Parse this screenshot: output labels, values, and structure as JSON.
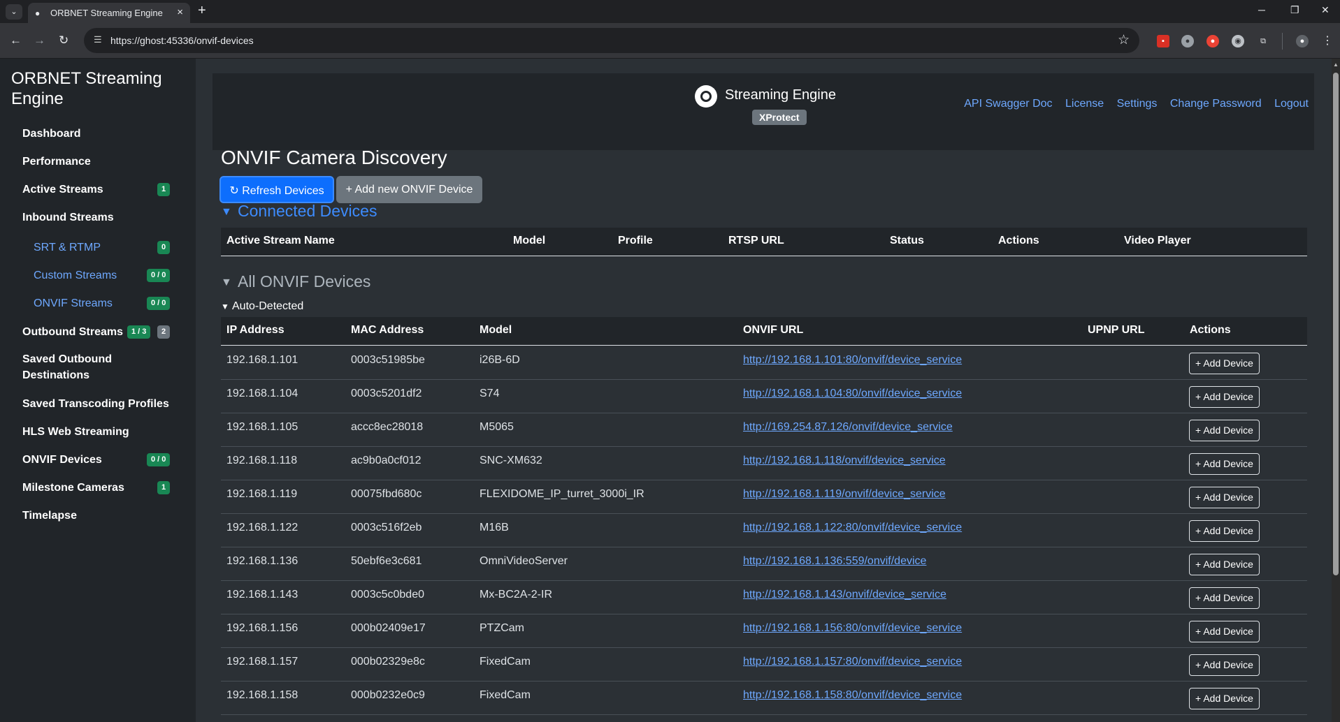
{
  "browser": {
    "tab_title": "ORBNET Streaming Engine",
    "url": "https://ghost:45336/onvif-devices"
  },
  "sidebar": {
    "brand": "ORBNET Streaming Engine",
    "items": [
      {
        "label": "Dashboard"
      },
      {
        "label": "Performance"
      },
      {
        "label": "Active Streams",
        "badge": "1"
      },
      {
        "label": "Inbound Streams"
      },
      {
        "label": "SRT & RTMP",
        "badge": "0"
      },
      {
        "label": "Custom Streams",
        "badge": "0 / 0"
      },
      {
        "label": "ONVIF Streams",
        "badge": "0 / 0"
      },
      {
        "label": "Outbound Streams",
        "badge": "1 / 3",
        "badge2": "2"
      },
      {
        "label": "Saved Outbound Destinations"
      },
      {
        "label": "Saved Transcoding Profiles"
      },
      {
        "label": "HLS Web Streaming"
      },
      {
        "label": "ONVIF Devices",
        "badge": "0 / 0"
      },
      {
        "label": "Milestone Cameras",
        "badge": "1"
      },
      {
        "label": "Timelapse"
      }
    ]
  },
  "header": {
    "title": "Streaming Engine",
    "edition_badge": "XProtect",
    "links": [
      "API Swagger Doc",
      "License",
      "Settings",
      "Change Password",
      "Logout"
    ]
  },
  "page": {
    "title": "ONVIF Camera Discovery",
    "refresh_label": "↻ Refresh Devices",
    "add_label": "+ Add new ONVIF Device"
  },
  "connected": {
    "heading": "Connected Devices",
    "columns": [
      "Active Stream Name",
      "Model",
      "Profile",
      "RTSP URL",
      "Status",
      "Actions",
      "Video Player"
    ]
  },
  "all_devices": {
    "heading": "All ONVIF Devices",
    "subheading": "Auto-Detected",
    "columns": [
      "IP Address",
      "MAC Address",
      "Model",
      "ONVIF URL",
      "UPNP URL",
      "Actions"
    ],
    "add_device_label": "+ Add Device",
    "rows": [
      {
        "ip": "192.168.1.101",
        "mac": "0003c51985be",
        "model": "i26B-6D",
        "url": "http://192.168.1.101:80/onvif/device_service",
        "upnp": ""
      },
      {
        "ip": "192.168.1.104",
        "mac": "0003c5201df2",
        "model": "S74",
        "url": "http://192.168.1.104:80/onvif/device_service",
        "upnp": ""
      },
      {
        "ip": "192.168.1.105",
        "mac": "accc8ec28018",
        "model": "M5065",
        "url": "http://169.254.87.126/onvif/device_service",
        "upnp": ""
      },
      {
        "ip": "192.168.1.118",
        "mac": "ac9b0a0cf012",
        "model": "SNC-XM632",
        "url": "http://192.168.1.118/onvif/device_service",
        "upnp": ""
      },
      {
        "ip": "192.168.1.119",
        "mac": "00075fbd680c",
        "model": "FLEXIDOME_IP_turret_3000i_IR",
        "url": "http://192.168.1.119/onvif/device_service",
        "upnp": ""
      },
      {
        "ip": "192.168.1.122",
        "mac": "0003c516f2eb",
        "model": "M16B",
        "url": "http://192.168.1.122:80/onvif/device_service",
        "upnp": ""
      },
      {
        "ip": "192.168.1.136",
        "mac": "50ebf6e3c681",
        "model": "OmniVideoServer",
        "url": "http://192.168.1.136:559/onvif/device",
        "upnp": ""
      },
      {
        "ip": "192.168.1.143",
        "mac": "0003c5c0bde0",
        "model": "Mx-BC2A-2-IR",
        "url": "http://192.168.1.143/onvif/device_service",
        "upnp": ""
      },
      {
        "ip": "192.168.1.156",
        "mac": "000b02409e17",
        "model": "PTZCam",
        "url": "http://192.168.1.156:80/onvif/device_service",
        "upnp": ""
      },
      {
        "ip": "192.168.1.157",
        "mac": "000b02329e8c",
        "model": "FixedCam",
        "url": "http://192.168.1.157:80/onvif/device_service",
        "upnp": ""
      },
      {
        "ip": "192.168.1.158",
        "mac": "000b0232e0c9",
        "model": "FixedCam",
        "url": "http://192.168.1.158:80/onvif/device_service",
        "upnp": ""
      }
    ]
  },
  "colors": {
    "primary": "#0d6efd",
    "success": "#198754",
    "link": "#6ea8fe",
    "sidebar_bg": "#212529",
    "main_bg": "#2b3035"
  }
}
